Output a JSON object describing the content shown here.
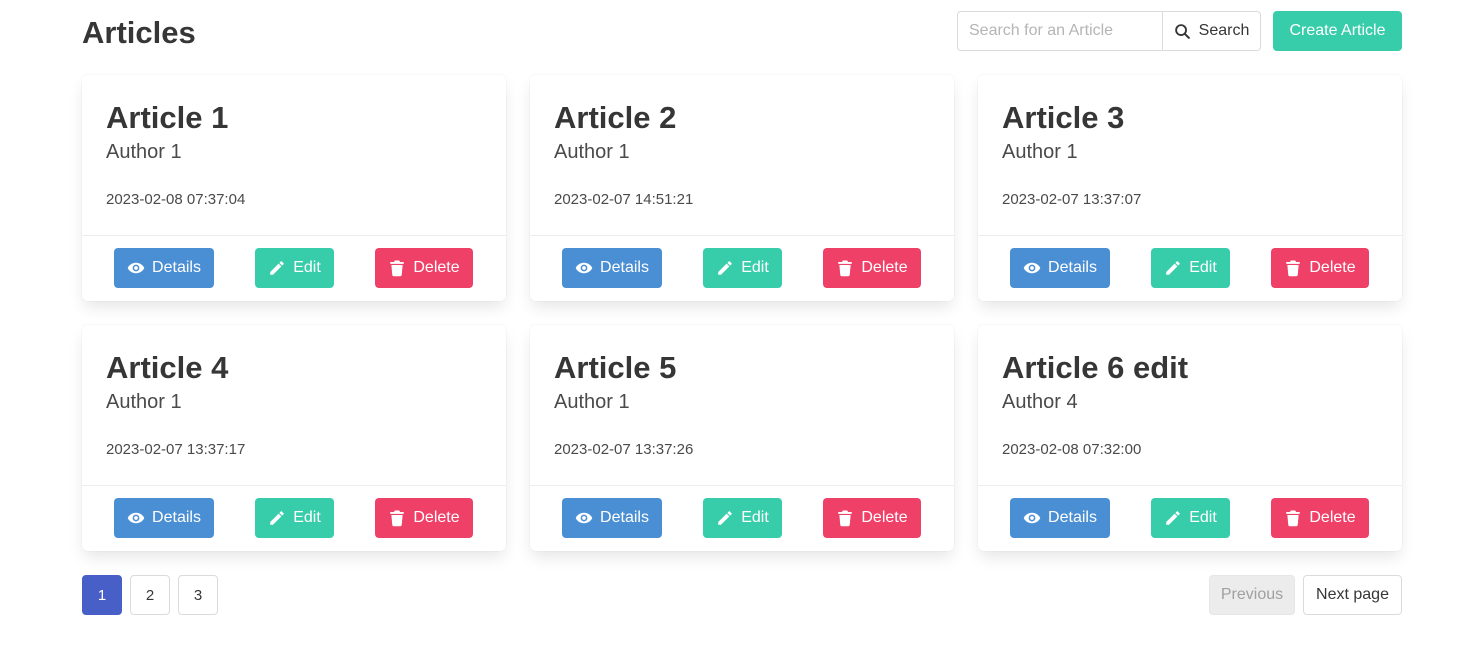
{
  "header": {
    "title": "Articles",
    "search_placeholder": "Search for an Article",
    "search_value": "",
    "search_label": "Search",
    "create_label": "Create Article"
  },
  "articles": [
    {
      "title": "Article 1",
      "author": "Author 1",
      "date": "2023-02-08 07:37:04"
    },
    {
      "title": "Article 2",
      "author": "Author 1",
      "date": "2023-02-07 14:51:21"
    },
    {
      "title": "Article 3",
      "author": "Author 1",
      "date": "2023-02-07 13:37:07"
    },
    {
      "title": "Article 4",
      "author": "Author 1",
      "date": "2023-02-07 13:37:17"
    },
    {
      "title": "Article 5",
      "author": "Author 1",
      "date": "2023-02-07 13:37:26"
    },
    {
      "title": "Article 6 edit",
      "author": "Author 4",
      "date": "2023-02-08 07:32:00"
    }
  ],
  "card_actions": {
    "details_label": "Details",
    "edit_label": "Edit",
    "delete_label": "Delete"
  },
  "pagination": {
    "pages": [
      "1",
      "2",
      "3"
    ],
    "current": "1",
    "previous_label": "Previous",
    "next_label": "Next page"
  },
  "colors": {
    "details": "#4a8ed4",
    "edit": "#37cdaa",
    "delete": "#ef4067",
    "current_page": "#485fc7"
  }
}
